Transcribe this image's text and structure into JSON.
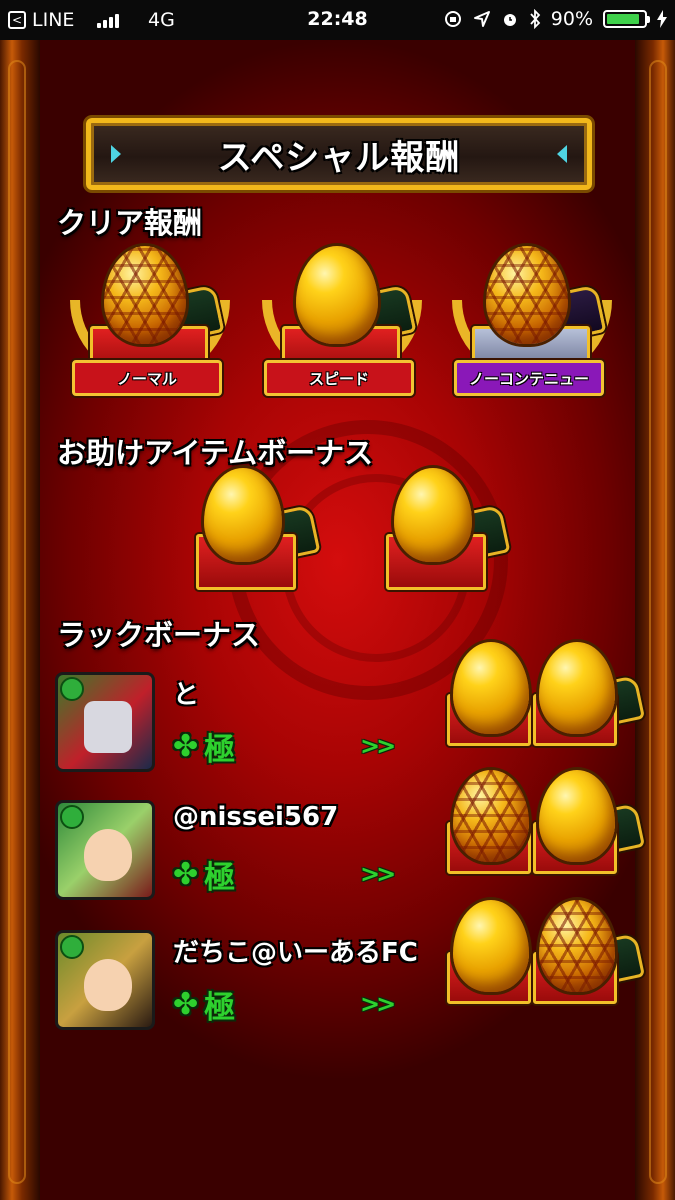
{
  "status_bar": {
    "back_app": "LINE",
    "back_glyph": "<",
    "network": "4G",
    "time": "22:48",
    "battery": "90%",
    "battery_level": 0.9,
    "battery_color": "#3fd14b",
    "icons": [
      "orientation-lock-icon",
      "location-arrow-icon",
      "alarm-icon",
      "bluetooth-icon",
      "charging-bolt-icon"
    ]
  },
  "banner": {
    "title": "スペシャル報酬"
  },
  "clear_rewards": {
    "title": "クリア報酬",
    "items": [
      {
        "label": "ノーマル",
        "egg": "hex",
        "ribbon_color": "#c8121a"
      },
      {
        "label": "スピード",
        "egg": "gold",
        "ribbon_color": "#c8121a"
      },
      {
        "label": "ノーコンテニュー",
        "egg": "hex",
        "ribbon_color": "#8a18b8"
      }
    ]
  },
  "helper_bonus": {
    "title": "お助けアイテムボーナス",
    "items": [
      {
        "egg": "gold"
      },
      {
        "egg": "gold"
      }
    ]
  },
  "luck_bonus": {
    "title": "ラックボーナス",
    "rows": [
      {
        "name": "と",
        "luck": "極",
        "arrows": ">>",
        "eggs": [
          "gold",
          "gold"
        ],
        "avatar_color": "#3b7b2a"
      },
      {
        "name": "@nissei567",
        "luck": "極",
        "arrows": ">>",
        "eggs": [
          "hex",
          "gold"
        ],
        "avatar_color": "#2e8a3a"
      },
      {
        "name": "だちこ@いーあるFC",
        "luck": "極",
        "arrows": ">>",
        "eggs": [
          "gold",
          "hex"
        ],
        "avatar_color": "#6a8a2a"
      }
    ]
  },
  "clover_glyph": "✤"
}
